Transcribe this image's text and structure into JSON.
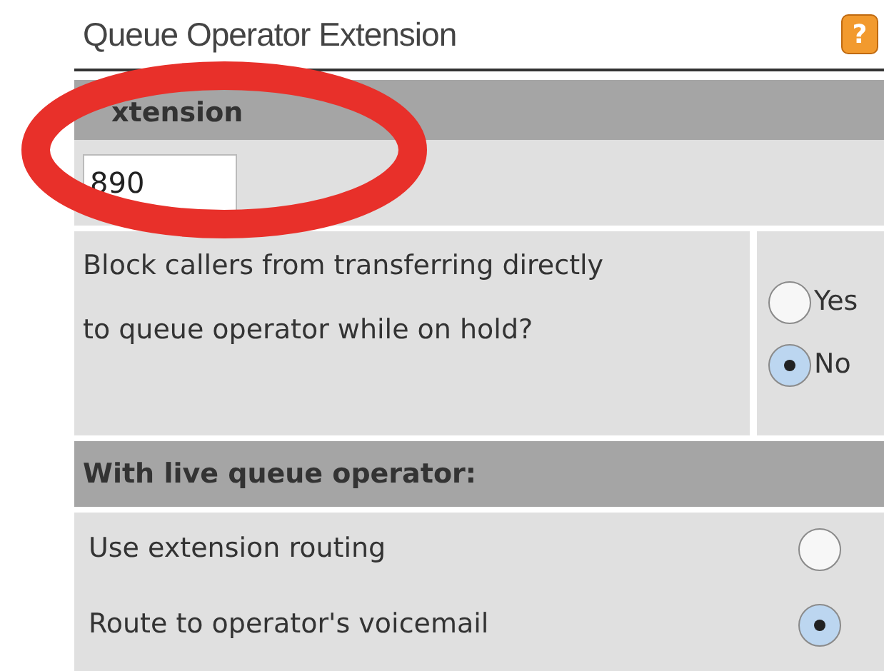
{
  "title": "Queue Operator Extension",
  "help_icon": "?",
  "extension_section": {
    "header": "xtension",
    "value": "890"
  },
  "block_question": {
    "label": "Block callers from transferring directly to queue operator while on hold?",
    "options": [
      {
        "label": "Yes",
        "selected": false
      },
      {
        "label": "No",
        "selected": true
      }
    ]
  },
  "live_section": {
    "header": "With live queue operator:",
    "options": [
      {
        "label": "Use extension routing",
        "selected": false
      },
      {
        "label": "Route to operator's voicemail",
        "selected": true
      }
    ]
  }
}
